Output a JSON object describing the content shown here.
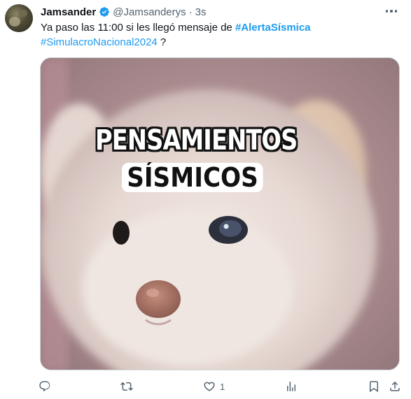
{
  "tweet": {
    "author_name": "Jamsander",
    "author_handle": "@Jamsanderys",
    "separator": "·",
    "time": "3s",
    "text_before": "Ya paso las 11:00 si les llegó mensaje de ",
    "hashtag_1": "#AlertaSísmica",
    "hashtag_2": "#SimulacroNacional2024",
    "text_after": " ?",
    "verified_icon": "verified-badge-icon",
    "accent_color": "#1d9bf0"
  },
  "media": {
    "caption_line1": "PENSAMIENTOS",
    "caption_line2": "SÍSMICOS",
    "description_icon": "dog-photo"
  },
  "actions": {
    "reply_count": "",
    "retweet_count": "",
    "like_count": "1",
    "views_count": ""
  }
}
